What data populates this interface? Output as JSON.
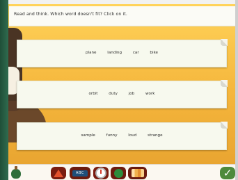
{
  "header": {
    "instruction": "Read and think. Which word doesn't fit? Click on it."
  },
  "cards": [
    {
      "words": [
        "plane",
        "landing",
        "car",
        "bike"
      ]
    },
    {
      "words": [
        "orbit",
        "duty",
        "job",
        "work"
      ]
    },
    {
      "words": [
        "sample",
        "funny",
        "loud",
        "strange"
      ]
    }
  ],
  "toolbar": {
    "keys_label": "ABC"
  },
  "colors": {
    "background_yellow": "#f5b63c",
    "card": "#f7f9ee",
    "toolbar_red": "#7a1c10",
    "check_green": "#4e8a3c"
  },
  "icons": [
    "potion-icon",
    "triangle-icon",
    "keyboard-icon",
    "dial-icon",
    "pacman-icon",
    "books-icon",
    "check-icon"
  ]
}
